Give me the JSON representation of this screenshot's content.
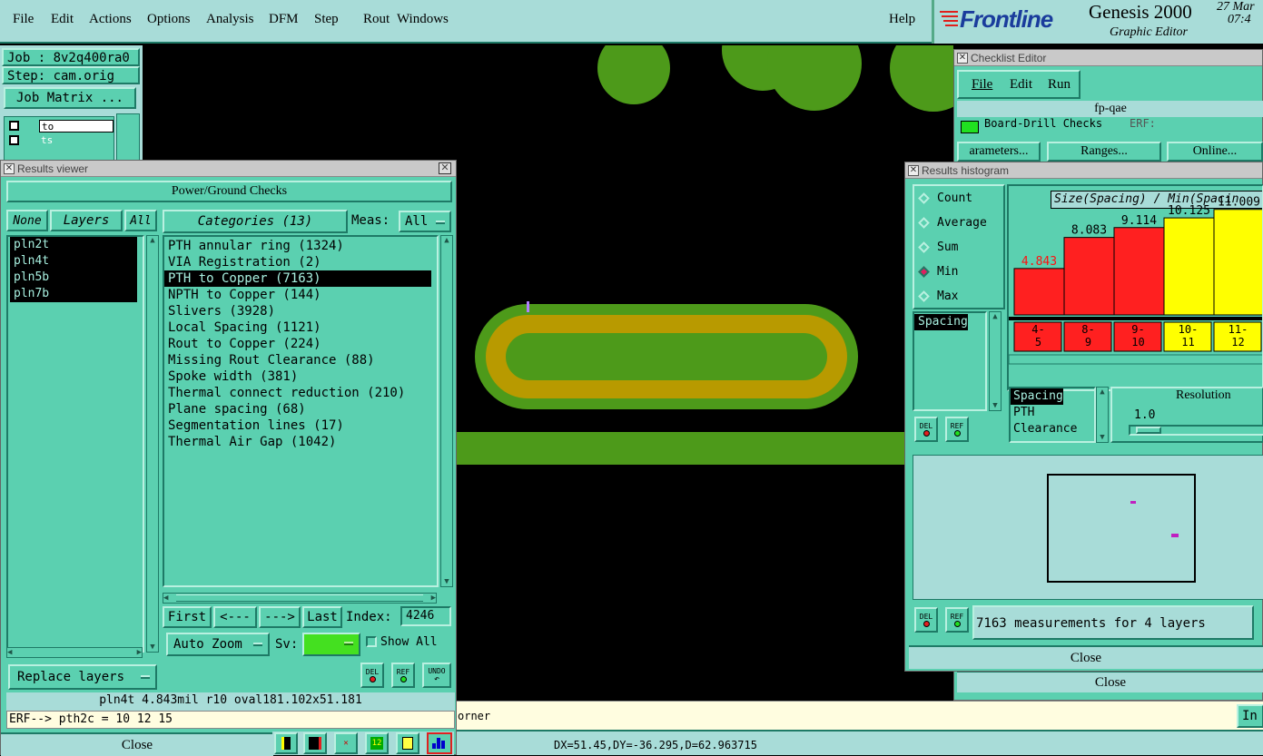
{
  "menubar": {
    "items": [
      "File",
      "Edit",
      "Actions",
      "Options",
      "Analysis",
      "DFM",
      "Step",
      "Rout",
      "Windows"
    ],
    "help": "Help"
  },
  "brand": {
    "logo": "Frontline",
    "product": "Genesis 2000",
    "subtitle": "Graphic Editor",
    "date": "27 Mar",
    "time": "07:4"
  },
  "job_panel": {
    "job": "Job : 8v2q400ra0",
    "step": "Step: cam.orig",
    "job_matrix": "Job Matrix ...",
    "layers": [
      "to",
      "ts"
    ]
  },
  "results_viewer": {
    "title": "Results viewer",
    "header": "Power/Ground Checks",
    "none_btn": "None",
    "layers_btn": "Layers",
    "all_btn": "All",
    "layers": [
      "pln2t",
      "pln4t",
      "pln5b",
      "pln7b"
    ],
    "categories_label": "Categories (13)",
    "meas_label": "Meas:",
    "meas_value": "All",
    "categories": [
      "PTH annular ring (1324)",
      "VIA Registration (2)",
      "PTH to Copper (7163)",
      "NPTH to Copper (144)",
      "Slivers (3928)",
      "Local Spacing (1121)",
      "Rout to Copper (224)",
      "Missing Rout Clearance (88)",
      "Spoke width (381)",
      "Thermal connect reduction (210)",
      "Plane spacing (68)",
      "Segmentation lines (17)",
      "Thermal Air Gap (1042)"
    ],
    "selected_category": "PTH to Copper (7163)",
    "first": "First",
    "prev": "<---",
    "next": "--->",
    "last": "Last",
    "index_label": "Index:",
    "index_value": "4246",
    "auto_zoom": "Auto Zoom",
    "sv_label": "Sv:",
    "show_all": "Show All",
    "replace_layers": "Replace layers",
    "del": "DEL",
    "ref": "REF",
    "undo": "UNDO",
    "status": "pln4t 4.843mil  r10  oval181.102x51.181",
    "erf": "ERF--> pth2c = 10 12 15",
    "close": "Close"
  },
  "canvas": {
    "status_fragment": "orner",
    "coords": "DX=51.45,DY=-36.295,D=62.963715",
    "right_btn": "In"
  },
  "checklist_editor": {
    "title": "Checklist Editor",
    "menu": [
      "File",
      "Edit",
      "Run"
    ],
    "name": "fp-qae",
    "row": "Board-Drill Checks",
    "erf": "ERF:",
    "buttons": [
      "arameters...",
      "Ranges...",
      "Online..."
    ],
    "close": "Close"
  },
  "histogram": {
    "title": "Results histogram",
    "modes": [
      "Count",
      "Average",
      "Sum",
      "Min",
      "Max"
    ],
    "selected_mode": "Min",
    "list_item": "Spacing",
    "chart_title": "Size(Spacing) / Min(Spacin",
    "chart_data": {
      "type": "bar",
      "categories": [
        "4-5",
        "8-9",
        "9-10",
        "10-11",
        "11-12"
      ],
      "values": [
        4.843,
        8.083,
        9.114,
        10.125,
        11.009
      ],
      "labels": [
        "4.843",
        "8.083",
        "9.114",
        "10.125",
        "11.009"
      ],
      "colors": [
        "#ff2020",
        "#ff2020",
        "#ff2020",
        "#ffff00",
        "#ffff00"
      ],
      "label_colors": [
        "#ff1010",
        "#000000",
        "#000000",
        "#000000",
        "#000000"
      ],
      "bin_labels": [
        [
          "4-",
          "5"
        ],
        [
          "8-",
          "9"
        ],
        [
          "9-",
          "10"
        ],
        [
          "10-",
          "11"
        ],
        [
          "11-",
          "12"
        ]
      ],
      "ylim": [
        0,
        12.5
      ]
    },
    "sublist": [
      "Spacing",
      "PTH",
      "Clearance"
    ],
    "resolution_label": "Resolution",
    "resolution_value": "1.0",
    "summary": "7163 measurements for 4 layers",
    "del": "DEL",
    "ref": "REF",
    "close": "Close"
  }
}
